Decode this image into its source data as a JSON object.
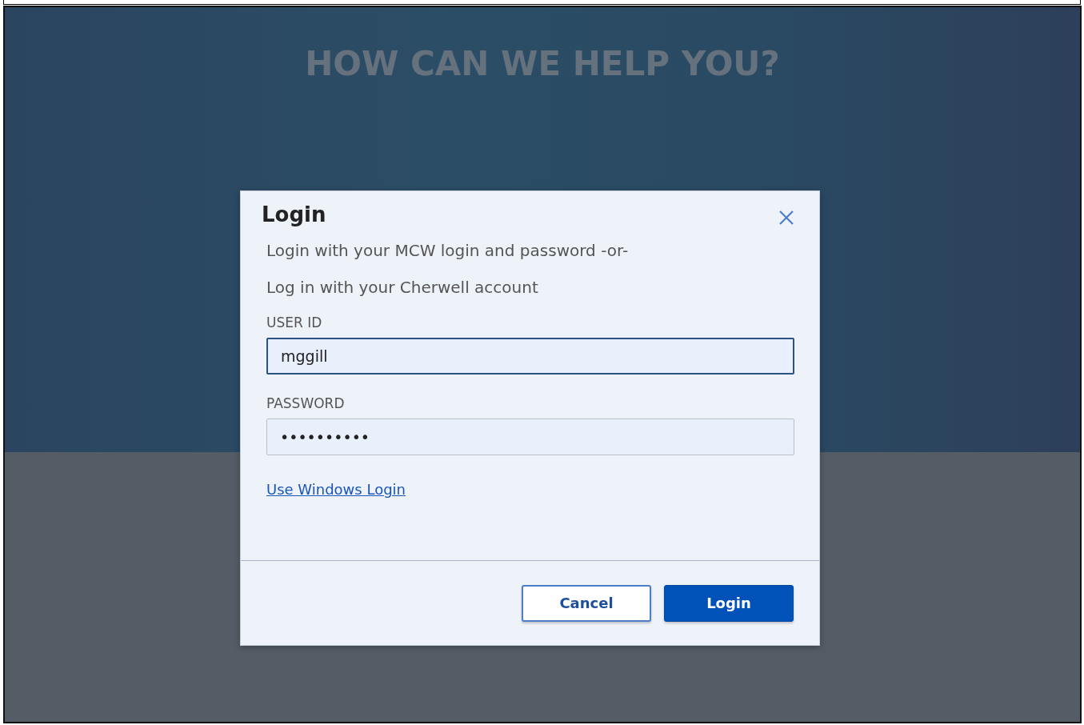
{
  "page": {
    "heading": "HOW CAN WE HELP YOU?"
  },
  "dialog": {
    "title": "Login",
    "messages": [
      "Login with your MCW login and password -or-",
      "Log in with your Cherwell account"
    ],
    "fields": [
      {
        "label": "USER ID",
        "value": "mggill",
        "focused": true
      },
      {
        "label": "PASSWORD",
        "value": "••••••••••",
        "focused": false
      }
    ],
    "link": "Use Windows Login",
    "buttons": [
      {
        "label": "Cancel",
        "kind": "secondary"
      },
      {
        "label": "Login",
        "kind": "primary"
      }
    ]
  }
}
